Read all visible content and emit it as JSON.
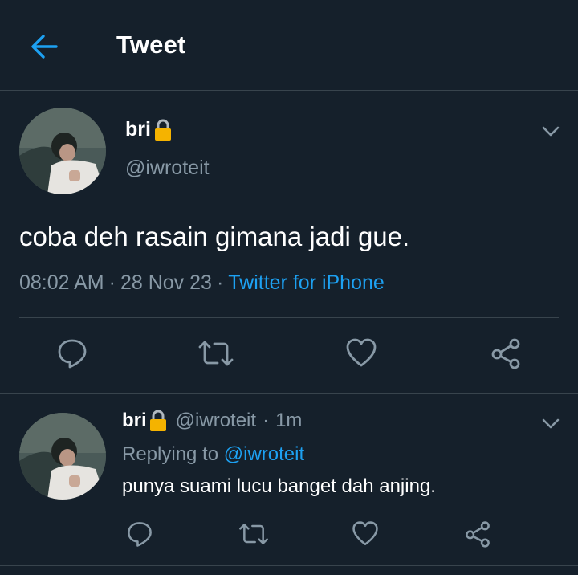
{
  "header": {
    "title": "Tweet",
    "back_icon": "arrow-left-icon"
  },
  "colors": {
    "background": "#15202b",
    "divider": "#38444d",
    "secondary": "#8899a6",
    "accent": "#1da1f2",
    "lock": "#f5b300"
  },
  "tweet": {
    "name": "bri",
    "handle": "@iwroteit",
    "text": "coba deh rasain gimana jadi gue.",
    "time": "08:02 AM",
    "date": "28 Nov 23",
    "separator": "·",
    "source": "Twitter for iPhone",
    "actions": [
      "reply-icon",
      "retweet-icon",
      "like-icon",
      "share-icon"
    ]
  },
  "reply": {
    "name": "bri",
    "handle": "@iwroteit",
    "separator": "·",
    "time": "1m",
    "replying_label": "Replying to",
    "replying_to": "@iwroteit",
    "text": "punya suami lucu banget dah anjing.",
    "actions": [
      "reply-icon",
      "retweet-icon",
      "like-icon",
      "share-icon"
    ]
  }
}
